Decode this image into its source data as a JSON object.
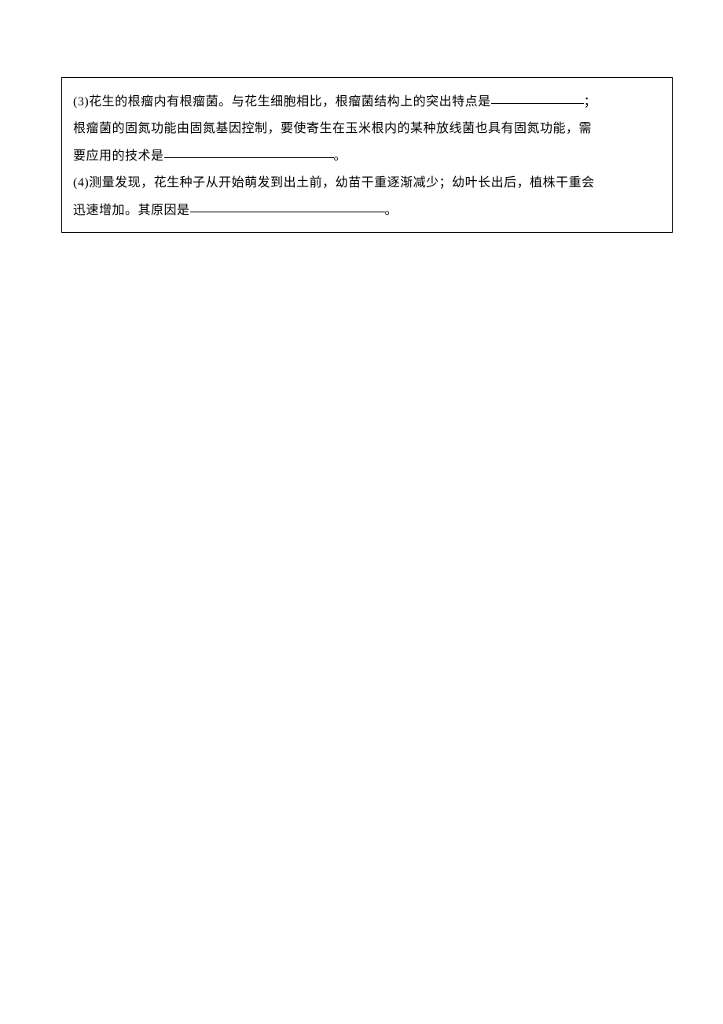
{
  "content": {
    "line1_prefix": "(3)花生的根瘤内有根瘤菌。与花生细胞相比，根瘤菌结构上的突出特点是",
    "line1_suffix": "；",
    "line2": "根瘤菌的固氮功能由固氮基因控制，要使寄生在玉米根内的某种放线菌也具有固氮功能，需",
    "line3_prefix": "要应用的技术是",
    "line3_suffix": "。",
    "line4": "(4)测量发现，花生种子从开始萌发到出土前，幼苗干重逐渐减少；幼叶长出后，植株干重会",
    "line5_prefix": "迅速增加。其原因是",
    "line5_suffix": "。"
  }
}
